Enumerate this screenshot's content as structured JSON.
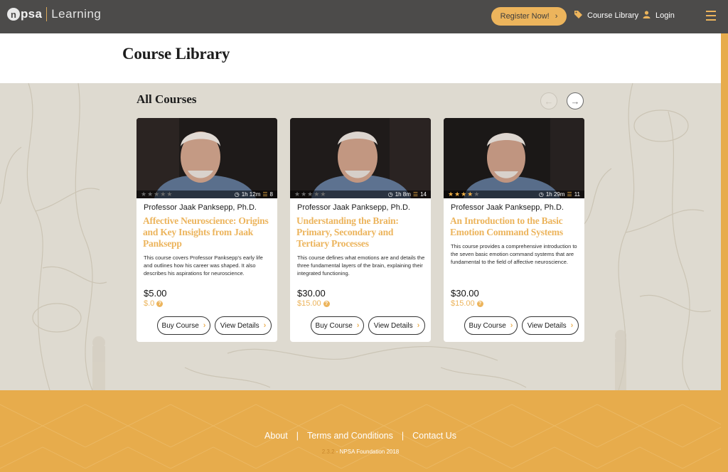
{
  "header": {
    "logo_mark": "n",
    "logo_text": "psa",
    "logo_sub": "Learning",
    "register_label": "Register Now!",
    "register_chevron": "›",
    "library_label": "Course Library",
    "login_label": "Login",
    "colors": {
      "bar": "#4c4b4a",
      "accent": "#ecb45c"
    }
  },
  "page": {
    "title": "Course Library"
  },
  "section": {
    "title": "All Courses",
    "prev_icon": "←",
    "next_icon": "→"
  },
  "courses": [
    {
      "rating": 0,
      "duration": "1h 12m",
      "lessons": "8",
      "author": "Professor Jaak Panksepp, Ph.D.",
      "title": "Affective Neuroscience: Origins and Key Insights from Jaak Panksepp",
      "description": "This course covers Professor Panksepp's early life and outlines how his career was shaped. It also describes his aspirations for neuroscience.",
      "price": "$5.00",
      "sale_price": "$.0",
      "buy_label": "Buy Course",
      "details_label": "View Details"
    },
    {
      "rating": 0,
      "duration": "1h 8m",
      "lessons": "14",
      "author": "Professor Jaak Panksepp, Ph.D.",
      "title": "Understanding the Brain: Primary, Secondary and Tertiary Processes",
      "description": "This course defines what emotions are and details the three fundamental layers of the brain, explaining their integrated functioning.",
      "price": "$30.00",
      "sale_price": "$15.00",
      "buy_label": "Buy Course",
      "details_label": "View Details"
    },
    {
      "rating": 4,
      "duration": "1h 29m",
      "lessons": "11",
      "author": "Professor Jaak Panksepp, Ph.D.",
      "title": "An Introduction to the Basic Emotion Command Systems",
      "description": "This course provides a comprehensive introduction to the seven basic emotion command systems that are fundamental to the field of affective neuroscience.",
      "price": "$30.00",
      "sale_price": "$15.00",
      "buy_label": "Buy Course",
      "details_label": "View Details"
    }
  ],
  "footer": {
    "about": "About",
    "terms": "Terms and Conditions",
    "contact": "Contact Us",
    "separator": "|",
    "version": "2.3.2",
    "copyright": " - NPSA Foundation 2018"
  }
}
